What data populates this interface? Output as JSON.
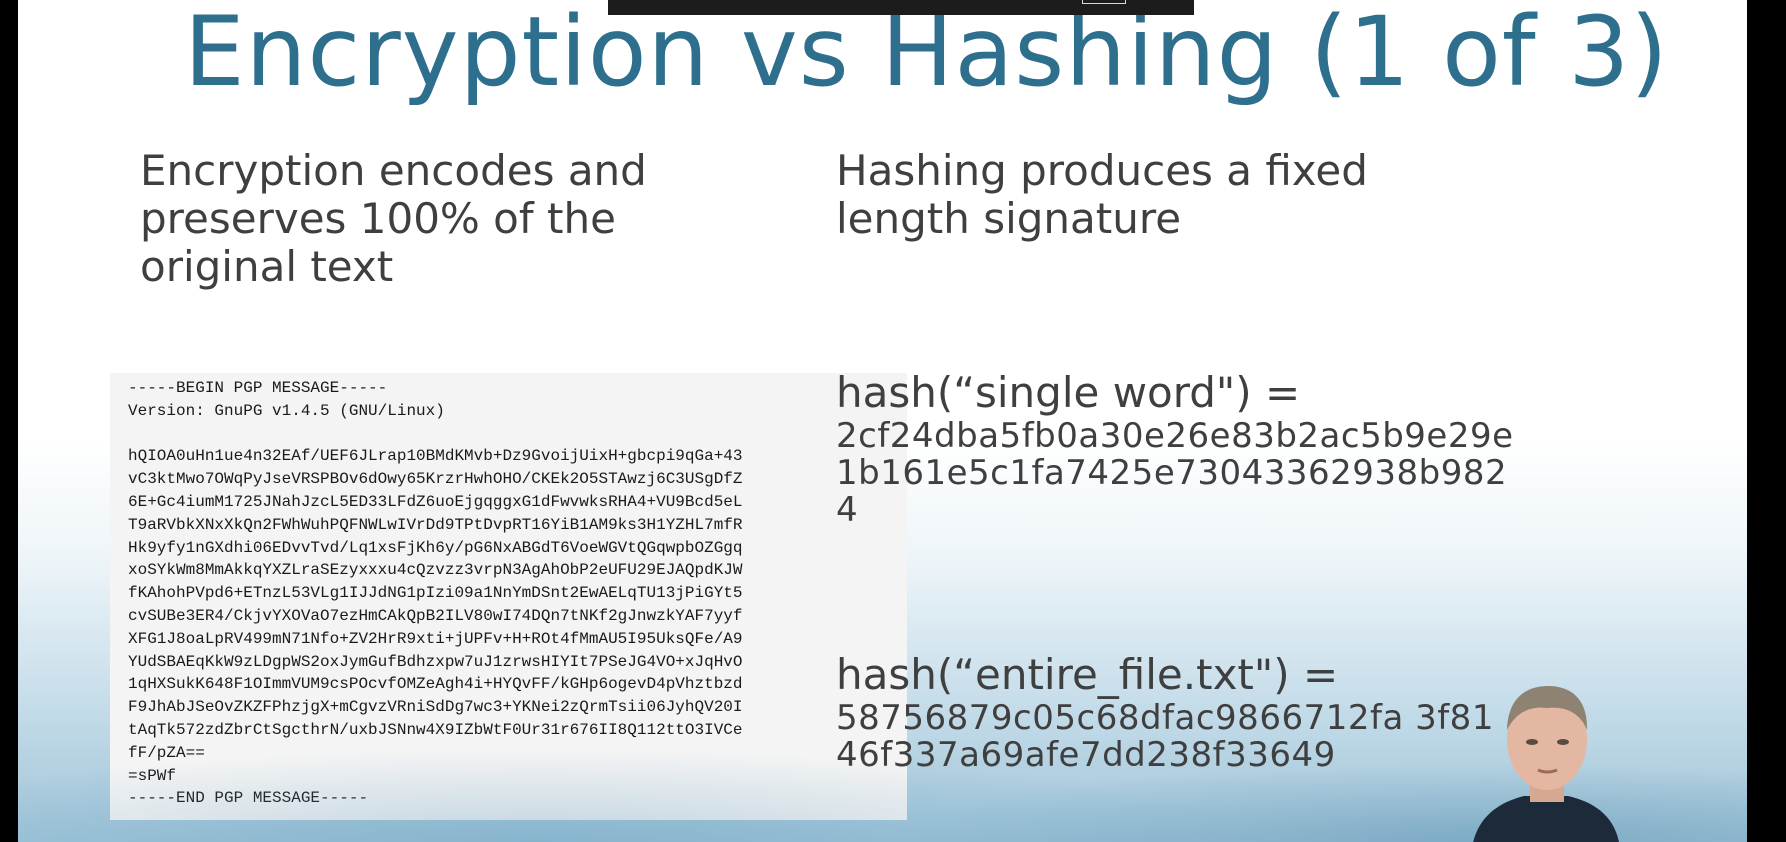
{
  "slide": {
    "title": "Encryption vs Hashing (1 of 3)",
    "encryption_bullet": "Encryption encodes and preserves 100% of the original text",
    "hashing_bullet": "Hashing produces a fixed length signature"
  },
  "pgp_message": {
    "lines": [
      "-----BEGIN PGP MESSAGE-----",
      "Version: GnuPG v1.4.5 (GNU/Linux)",
      "",
      "hQIOA0uHn1ue4n32EAf/UEF6JLrap10BMdKMvb+Dz9GvoijUixH+gbcpi9qGa+43",
      "vC3ktMwo7OWqPyJseVRSPBOv6dOwy65KrzrHwhOHO/CKEk2O5STAwzj6C3USgDfZ",
      "6E+Gc4iumM1725JNahJzcL5ED33LFdZ6uoEjgqggxG1dFwvwksRHA4+VU9Bcd5eL",
      "T9aRVbkXNxXkQn2FWhWuhPQFNWLwIVrDd9TPtDvpRT16YiB1AM9ks3H1YZHL7mfR",
      "Hk9yfy1nGXdhi06EDvvTvd/Lq1xsFjKh6y/pG6NxABGdT6VoeWGVtQGqwpbOZGgq",
      "xoSYkWm8MmAkkqYXZLraSEzyxxxu4cQzvzz3vrpN3AgAhObP2eUFU29EJAQpdKJW",
      "fKAhohPVpd6+ETnzL53VLg1IJJdNG1pIzi09a1NnYmDSnt2EwAELqTU13jPiGYt5",
      "cvSUBe3ER4/CkjvYXOVaO7ezHmCAkQpB2ILV80wI74DQn7tNKf2gJnwzkYAF7yyf",
      "XFG1J8oaLpRV499mN71Nfo+ZV2HrR9xti+jUPFv+H+ROt4fMmAU5I95UksQFe/A9",
      "YUdSBAEqKkW9zLDgpWS2oxJymGufBdhzxpw7uJ1zrwsHIYIt7PSeJG4VO+xJqHvO",
      "1qHXSukK648F1OImmVUM9csPOcvfOMZeAgh4i+HYQvFF/kGHp6ogevD4pVhztbzd",
      "F9JhAbJSeOvZKZFPhzjgX+mCgvzVRniSdDg7wc3+YKNei2zQrmTsii06JyhQV20I",
      "tAqTk572zdZbrCtSgcthrN/uxbJSNnw4X9IZbWtF0Ur31r676II8Q112ttO3IVCe",
      "fF/pZA==",
      "=sPWf",
      "-----END PGP MESSAGE-----"
    ]
  },
  "hash_examples": [
    {
      "call": "hash(“single word\") =",
      "digest": "2cf24dba5fb0a30e26e83b2ac5b9e29e1b161e5c1fa7425e73043362938b9824"
    },
    {
      "call": "hash(“entire_file.txt\") =",
      "digest": "58756879c05c68dfac9866712fa  3f8146f337a69afe7dd238f33649"
    }
  ]
}
